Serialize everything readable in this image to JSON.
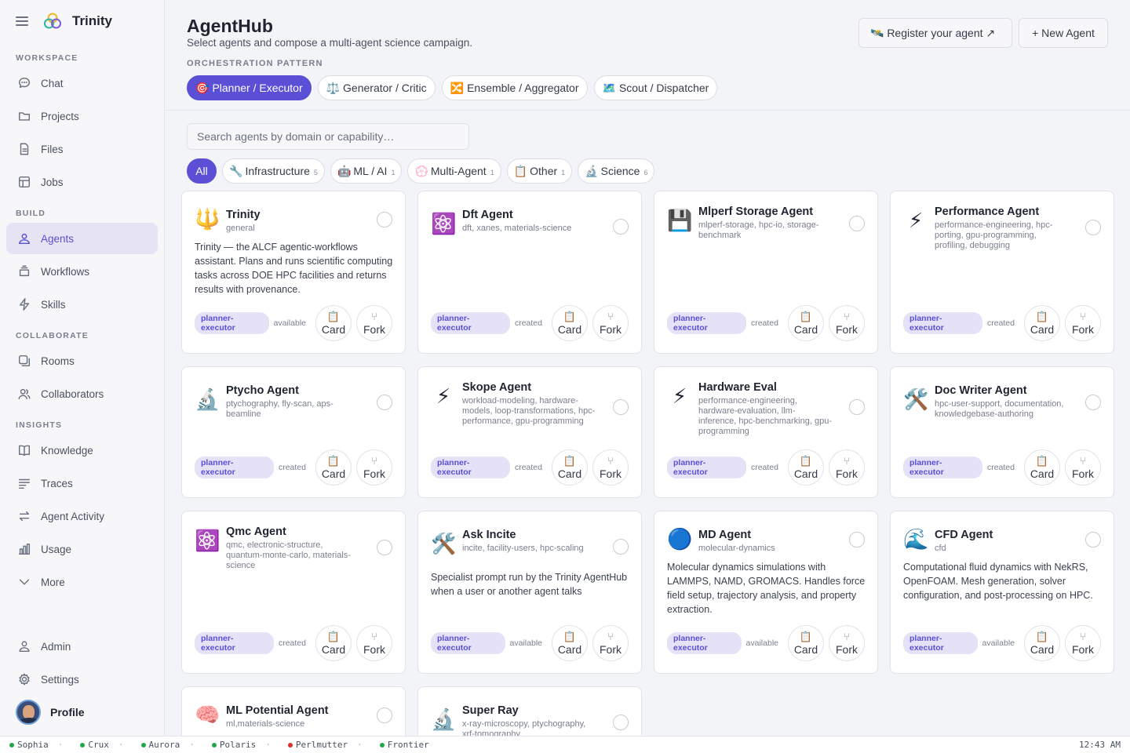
{
  "app": {
    "name": "Trinity"
  },
  "sidebar": {
    "sections": [
      {
        "label": "WORKSPACE",
        "items": [
          {
            "label": "Chat",
            "icon": "chat-icon"
          },
          {
            "label": "Projects",
            "icon": "folder-icon"
          },
          {
            "label": "Files",
            "icon": "file-icon"
          },
          {
            "label": "Jobs",
            "icon": "table-icon"
          }
        ]
      },
      {
        "label": "BUILD",
        "items": [
          {
            "label": "Agents",
            "icon": "agents-icon",
            "active": true
          },
          {
            "label": "Workflows",
            "icon": "stack-icon"
          },
          {
            "label": "Skills",
            "icon": "bolt-icon"
          }
        ]
      },
      {
        "label": "COLLABORATE",
        "items": [
          {
            "label": "Rooms",
            "icon": "rooms-icon"
          },
          {
            "label": "Collaborators",
            "icon": "users-icon"
          }
        ]
      },
      {
        "label": "INSIGHTS",
        "items": [
          {
            "label": "Knowledge",
            "icon": "book-icon"
          },
          {
            "label": "Traces",
            "icon": "lines-icon"
          },
          {
            "label": "Agent Activity",
            "icon": "arrows-icon"
          },
          {
            "label": "Usage",
            "icon": "bar-chart-icon"
          },
          {
            "label": "More",
            "icon": "chevron-down-icon"
          }
        ]
      }
    ],
    "bottom": [
      {
        "label": "Admin",
        "icon": "admin-icon"
      },
      {
        "label": "Settings",
        "icon": "gear-icon"
      }
    ],
    "profile": {
      "label": "Profile"
    }
  },
  "header": {
    "title": "AgentHub",
    "subtitle": "Select agents and compose a multi-agent science campaign.",
    "orchestration_label": "ORCHESTRATION PATTERN",
    "register_button": "🛰️ Register your agent ↗",
    "new_agent_button": "+ New Agent",
    "patterns": [
      {
        "icon": "🎯",
        "label": "Planner / Executor",
        "active": true
      },
      {
        "icon": "⚖️",
        "label": "Generator / Critic"
      },
      {
        "icon": "🔀",
        "label": "Ensemble / Aggregator"
      },
      {
        "icon": "🗺️",
        "label": "Scout / Dispatcher"
      }
    ]
  },
  "search": {
    "placeholder": "Search agents by domain or capability…"
  },
  "filters": [
    {
      "label": "All",
      "active": true
    },
    {
      "icon": "🔧",
      "label": "Infrastructure",
      "count": "5"
    },
    {
      "icon": "🤖",
      "label": "ML / AI",
      "count": "1"
    },
    {
      "icon": "💮",
      "label": "Multi-Agent",
      "count": "1"
    },
    {
      "icon": "📋",
      "label": "Other",
      "count": "1"
    },
    {
      "icon": "🔬",
      "label": "Science",
      "count": "6"
    }
  ],
  "card_actions": {
    "card_icon": "📋",
    "card_label": "Card",
    "fork_icon": "⑂",
    "fork_label": "Fork"
  },
  "agents": [
    {
      "icon": "🔱",
      "name": "Trinity",
      "tags": "general",
      "description": "Trinity — the ALCF agentic-workflows assistant. Plans and runs scientific computing tasks across DOE HPC facilities and returns results with provenance.",
      "badge": "planner-executor",
      "status": "available"
    },
    {
      "icon": "⚛️",
      "name": "Dft Agent",
      "tags": "dft, xanes, materials-science",
      "description": "",
      "badge": "planner-executor",
      "status": "created"
    },
    {
      "icon": "💾",
      "name": "Mlperf Storage Agent",
      "tags": "mlperf-storage, hpc-io, storage-benchmark",
      "description": "",
      "badge": "planner-executor",
      "status": "created"
    },
    {
      "icon": "⚡",
      "name": "Performance Agent",
      "tags": "performance-engineering, hpc-porting, gpu-programming, profiling, debugging",
      "description": "",
      "badge": "planner-executor",
      "status": "created"
    },
    {
      "icon": "🔬",
      "name": "Ptycho Agent",
      "tags": "ptychography, fly-scan, aps-beamline",
      "description": "",
      "badge": "planner-executor",
      "status": "created"
    },
    {
      "icon": "⚡",
      "name": "Skope Agent",
      "tags": "workload-modeling, hardware-models, loop-transformations, hpc-performance, gpu-programming",
      "description": "",
      "badge": "planner-executor",
      "status": "created"
    },
    {
      "icon": "⚡",
      "name": "Hardware Eval",
      "tags": "performance-engineering, hardware-evaluation, llm-inference, hpc-benchmarking, gpu-programming",
      "description": "",
      "badge": "planner-executor",
      "status": "created"
    },
    {
      "icon": "🛠️",
      "name": "Doc Writer Agent",
      "tags": "hpc-user-support, documentation, knowledgebase-authoring",
      "description": "",
      "badge": "planner-executor",
      "status": "created"
    },
    {
      "icon": "⚛️",
      "name": "Qmc Agent",
      "tags": "qmc, electronic-structure, quantum-monte-carlo, materials-science",
      "description": "",
      "badge": "planner-executor",
      "status": "created"
    },
    {
      "icon": "🛠️",
      "name": "Ask Incite",
      "tags": "incite, facility-users, hpc-scaling",
      "description": "Specialist prompt run by the Trinity AgentHub when a user or another agent talks",
      "badge": "planner-executor",
      "status": "available"
    },
    {
      "icon": "🔵",
      "name": "MD Agent",
      "tags": "molecular-dynamics",
      "description": "Molecular dynamics simulations with LAMMPS, NAMD, GROMACS. Handles force field setup, trajectory analysis, and property extraction.",
      "badge": "planner-executor",
      "status": "available"
    },
    {
      "icon": "🌊",
      "name": "CFD Agent",
      "tags": "cfd",
      "description": "Computational fluid dynamics with NekRS, OpenFOAM. Mesh generation, solver configuration, and post-processing on HPC.",
      "badge": "planner-executor",
      "status": "available"
    },
    {
      "icon": "🧠",
      "name": "ML Potential Agent",
      "tags": "ml,materials-science",
      "description": "",
      "badge": "",
      "status": ""
    },
    {
      "icon": "🔬",
      "name": "Super Ray",
      "tags": "x-ray-microscopy, ptychography, xrf-tomography",
      "description": "",
      "badge": "",
      "status": ""
    }
  ],
  "statusbar": {
    "systems": [
      {
        "name": "Sophia",
        "color": "#22a84a"
      },
      {
        "name": "Crux",
        "color": "#22a84a"
      },
      {
        "name": "Aurora",
        "color": "#22a84a"
      },
      {
        "name": "Polaris",
        "color": "#22a84a"
      },
      {
        "name": "Perlmutter",
        "color": "#e0302a"
      },
      {
        "name": "Frontier",
        "color": "#22a84a"
      }
    ],
    "clock": "12:43 AM"
  }
}
